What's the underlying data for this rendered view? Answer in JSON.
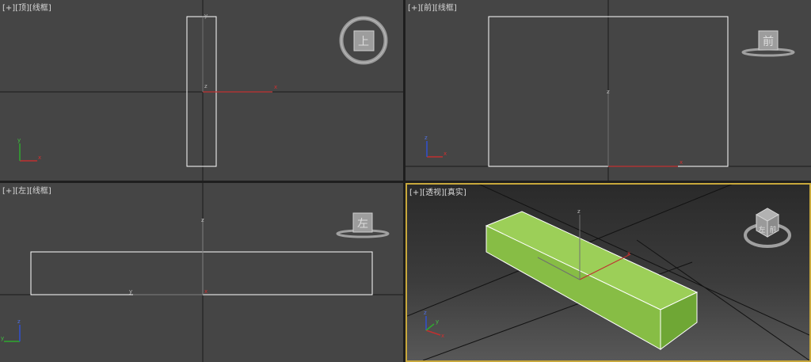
{
  "viewports": {
    "top": {
      "menu": "[+]",
      "view": "[顶]",
      "shading": "[线框]",
      "cube_face": "上"
    },
    "front": {
      "menu": "[+]",
      "view": "[前]",
      "shading": "[线框]",
      "cube_face": "前"
    },
    "left": {
      "menu": "[+]",
      "view": "[左]",
      "shading": "[线框]",
      "cube_face": "左"
    },
    "persp": {
      "menu": "[+]",
      "view": "[透视]",
      "shading": "[真实]",
      "cube_face": "左",
      "cube_face_2": "前"
    }
  },
  "axes": {
    "x": "x",
    "y": "y",
    "z": "z"
  },
  "colors": {
    "viewport_bg": "#454545",
    "active_border": "#c8a83c",
    "box_fill": "#8ec549",
    "box_edge": "#ffffff",
    "axis_x": "#d03030",
    "axis_y": "#30c030",
    "axis_z": "#3050d0"
  },
  "icons": [
    "viewcube-icon",
    "axis-tripod-icon"
  ]
}
